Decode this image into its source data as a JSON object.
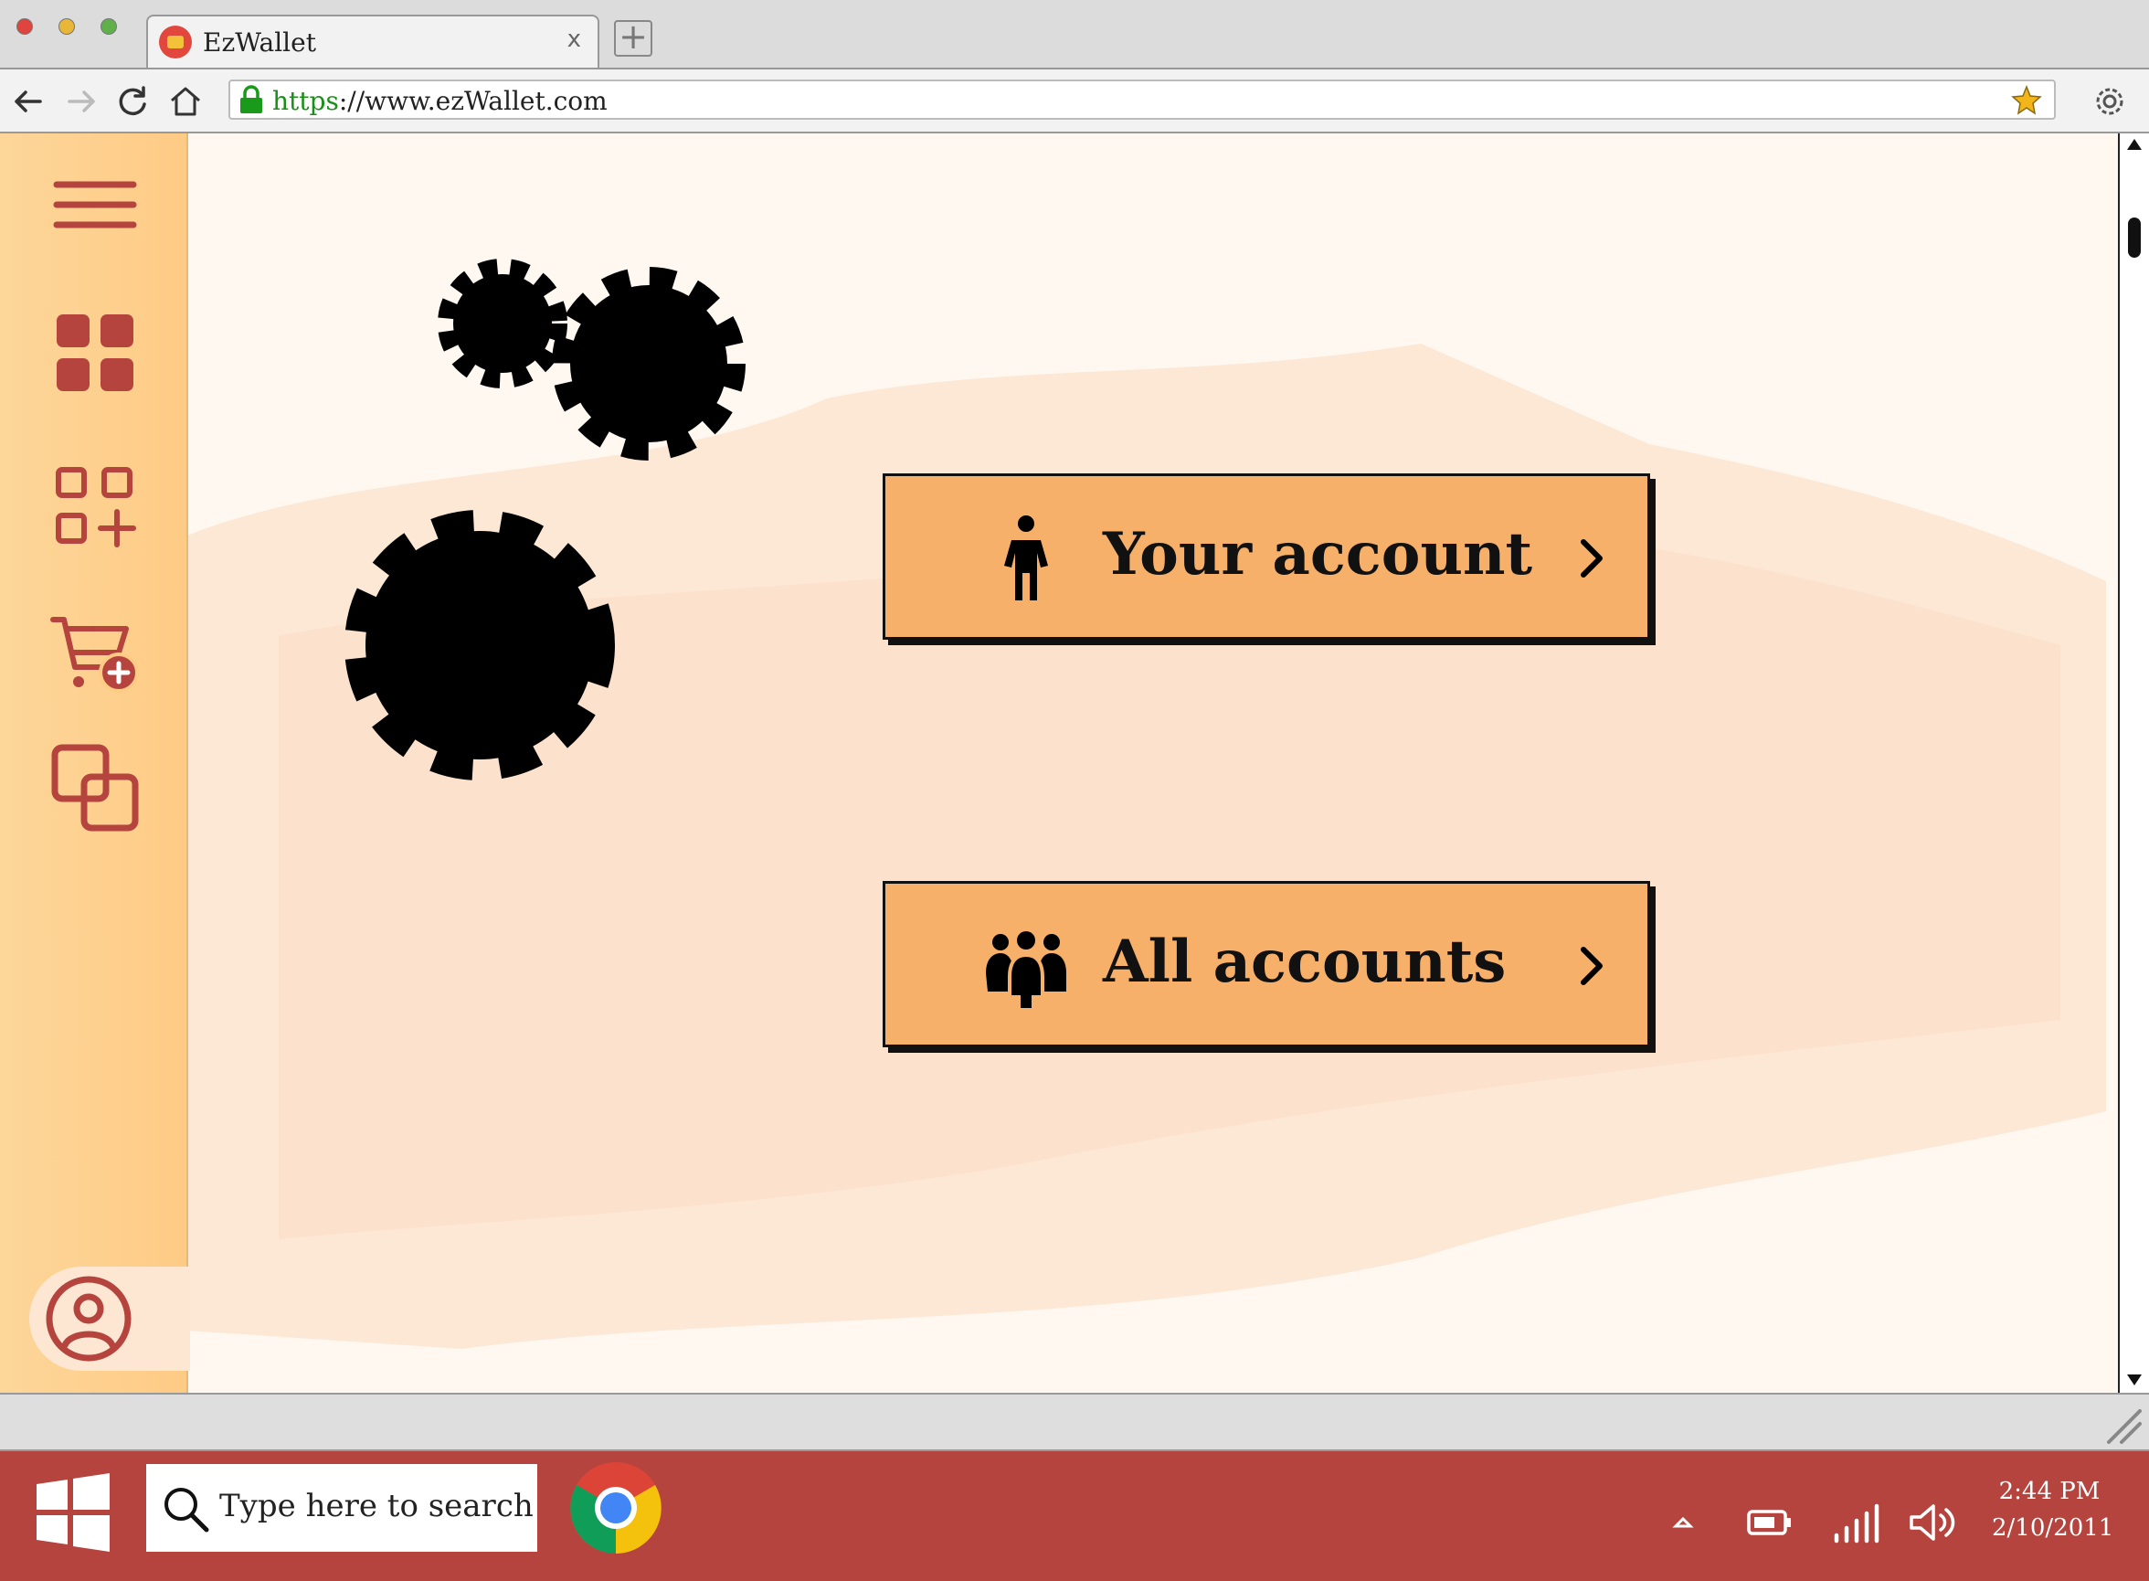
{
  "browser": {
    "tab_title": "EzWallet",
    "tab_close": "x",
    "new_tab": "+",
    "url_protocol": "https",
    "url_rest": "://www.ezWallet.com"
  },
  "main": {
    "buttons": [
      {
        "label": "Your account",
        "icon": "person-icon"
      },
      {
        "label": "All accounts",
        "icon": "group-icon"
      }
    ]
  },
  "sidebar": {
    "items": [
      "menu-icon",
      "dashboard-icon",
      "add-widget-icon",
      "cart-add-icon",
      "copy-icon"
    ],
    "profile_icon": "user-circle-icon"
  },
  "taskbar": {
    "search_placeholder": "Type here to search",
    "time": "2:44 PM",
    "date": "2/10/2011"
  },
  "colors": {
    "accent": "#b5443e",
    "sidebar": "#fecb85",
    "button": "#f6b06a",
    "background": "#fff8f0"
  }
}
